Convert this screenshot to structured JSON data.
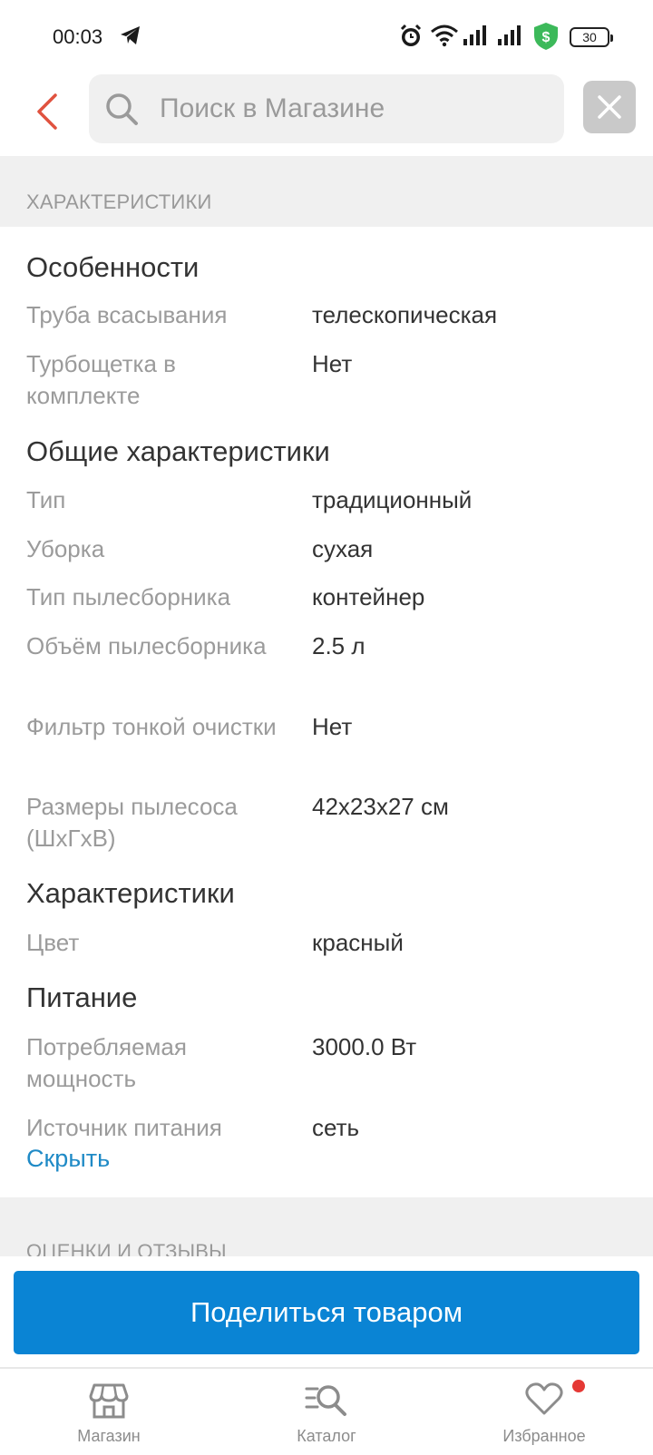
{
  "status_bar": {
    "time": "00:03",
    "battery": "30",
    "icons": [
      "telegram-icon",
      "alarm-icon",
      "wifi-icon",
      "signal-icon",
      "signal-icon",
      "shield-dollar-icon",
      "battery-icon"
    ],
    "shield_color": "#3cb95a"
  },
  "header": {
    "search_placeholder": "Поиск в Магазине",
    "back_color": "#e0523f"
  },
  "specs_section": {
    "title": "ХАРАКТЕРИСТИКИ",
    "groups": [
      {
        "title": "Особенности",
        "rows": [
          {
            "label": "Труба всасывания",
            "value": "телескопическая"
          },
          {
            "label": "Турбощетка в комплекте",
            "value": "Нет"
          }
        ]
      },
      {
        "title": "Общие характеристики",
        "rows": [
          {
            "label": "Тип",
            "value": "традиционный"
          },
          {
            "label": "Уборка",
            "value": "сухая"
          },
          {
            "label": "Тип пылесборника",
            "value": "контейнер"
          },
          {
            "label": "Объём пылесборника",
            "value": "2.5 л"
          },
          {
            "label": "Фильтр тонкой очистки",
            "value": "Нет"
          },
          {
            "label": "Размеры пылесоса (ШхГхВ)",
            "value": "42x23x27 см"
          }
        ]
      },
      {
        "title": "Характеристики",
        "rows": [
          {
            "label": "Цвет",
            "value": "красный"
          }
        ]
      },
      {
        "title": "Питание",
        "rows": [
          {
            "label": "Потребляемая мощность",
            "value": "3000.0 Вт"
          },
          {
            "label": "Источник питания",
            "value": "сеть"
          }
        ]
      }
    ],
    "hide_link": "Скрыть"
  },
  "reviews_section": {
    "title": "ОЦЕНКИ И ОТЗЫВЫ"
  },
  "share_button": "Поделиться товаром",
  "bottom_nav": {
    "items": [
      {
        "label": "Магазин",
        "icon": "store-icon"
      },
      {
        "label": "Каталог",
        "icon": "catalog-search-icon"
      },
      {
        "label": "Избранное",
        "icon": "heart-icon",
        "badge": true
      }
    ]
  },
  "colors": {
    "accent": "#0a84d4",
    "link": "#1f8ac6",
    "badge": "#e53935"
  }
}
